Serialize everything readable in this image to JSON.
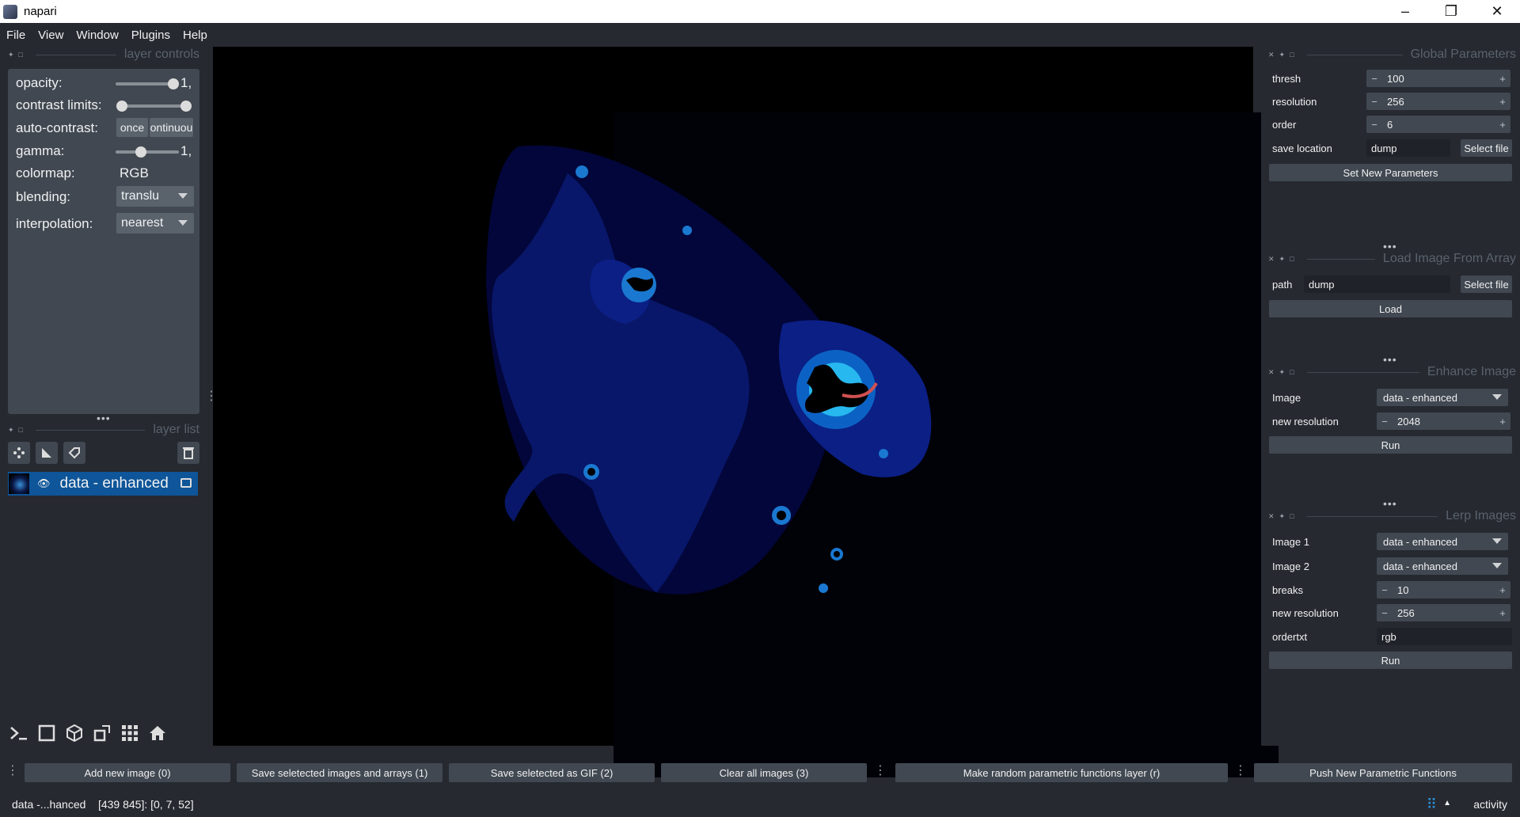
{
  "window": {
    "title": "napari"
  },
  "menu": [
    "File",
    "View",
    "Window",
    "Plugins",
    "Help"
  ],
  "layer_controls": {
    "header": "layer controls",
    "opacity_label": "opacity:",
    "opacity_value": "1,",
    "contrast_label": "contrast limits:",
    "autocontrast_label": "auto-contrast:",
    "once_btn": "once",
    "continuous_btn": "ontinuou",
    "gamma_label": "gamma:",
    "gamma_value": "1,",
    "colormap_label": "colormap:",
    "colormap_value": "RGB",
    "blending_label": "blending:",
    "blending_value": "translu",
    "interpolation_label": "interpolation:",
    "interpolation_value": "nearest"
  },
  "layer_list": {
    "header": "layer list",
    "layers": [
      {
        "name": "data - enhanced"
      }
    ]
  },
  "global_params": {
    "header": "Global Parameters",
    "thresh_label": "thresh",
    "thresh_value": "100",
    "resolution_label": "resolution",
    "resolution_value": "256",
    "order_label": "order",
    "order_value": "6",
    "save_label": "save location",
    "save_value": "dump",
    "select_file": "Select file",
    "set_button": "Set New Parameters"
  },
  "load_image": {
    "header": "Load Image From Array",
    "path_label": "path",
    "path_value": "dump",
    "select_file": "Select file",
    "load_button": "Load"
  },
  "enhance_image": {
    "header": "Enhance Image",
    "image_label": "Image",
    "image_value": "data - enhanced",
    "res_label": "new resolution",
    "res_value": "2048",
    "run_button": "Run"
  },
  "lerp_images": {
    "header": "Lerp Images",
    "image1_label": "Image 1",
    "image1_value": "data - enhanced",
    "image2_label": "Image 2",
    "image2_value": "data - enhanced",
    "breaks_label": "breaks",
    "breaks_value": "10",
    "res_label": "new resolution",
    "res_value": "256",
    "ordertxt_label": "ordertxt",
    "ordertxt_value": "rgb",
    "run_button": "Run"
  },
  "bottom_buttons": {
    "add": "Add new image (0)",
    "save_arrays": "Save seletected images and arrays (1)",
    "save_gif": "Save seletected as GIF (2)",
    "clear": "Clear all images (3)",
    "random": "Make random parametric functions layer (r)",
    "push": "Push New Parametric Functions"
  },
  "status": {
    "text": "data -...hanced    [439 845]: [0, 7, 52]",
    "activity": "activity"
  },
  "colors": {
    "accent": "#0e5599",
    "panel": "#414851",
    "bg": "#262930"
  }
}
